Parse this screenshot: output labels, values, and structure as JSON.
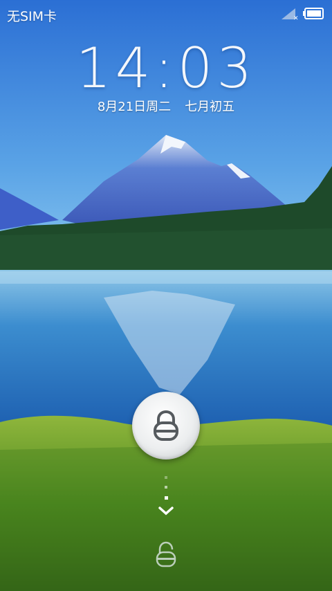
{
  "status_bar": {
    "carrier": "无SIM卡",
    "signal_icon": "no-signal-icon",
    "battery_icon": "battery-full-icon"
  },
  "lockscreen": {
    "time": "14:03",
    "date": "8月21日",
    "weekday": "周二",
    "lunar_date": "七月初五",
    "lock_icon": "padlock-icon",
    "hint_icon": "chevron-down-icon",
    "unlock_target_icon": "unlocked-padlock-icon"
  },
  "colors": {
    "sky_top": "#2b72d6",
    "mountain": "#3b5fc4",
    "forest": "#1f4a2a",
    "lake": "#2f86c9",
    "grass": "#6f9a2c",
    "text": "#ffffff"
  }
}
